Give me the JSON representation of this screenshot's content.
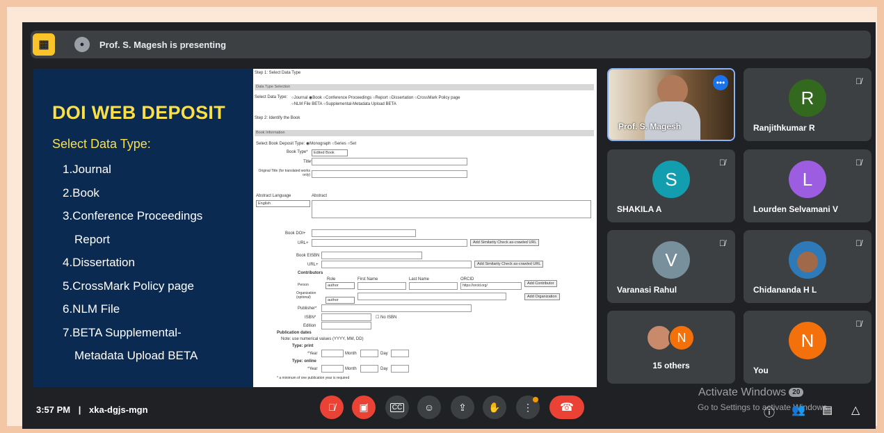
{
  "topbar": {
    "presenting_text": "Prof. S. Magesh is presenting"
  },
  "slide": {
    "title": "DOI WEB DEPOSIT",
    "subtitle": "Select Data Type:",
    "items": [
      "1.Journal",
      "2.Book",
      "3.Conference Proceedings",
      "Report",
      "4.Dissertation",
      "5.CrossMark Policy page",
      "6.NLM File",
      "7.BETA Supplemental-",
      "Metadata Upload BETA"
    ]
  },
  "form": {
    "step1": "Step 1: Select Data Type",
    "sec_type": "Data Type Selection",
    "select_label": "Select Data Type:",
    "types": "○Journal ◉Book ○Conference Proceedings ○Report ○Dissertation ○CrossMark Policy page",
    "types2": "○NLM File BETA ○Supplemental-Metadata Upload BETA",
    "step2": "Step 2: Identify the Book",
    "sec_book": "Book Information",
    "deposit_type": "Select Book Deposit Type:  ◉Monograph ○Series ○Set",
    "book_type_label": "Book Type*",
    "book_type_value": "Edited Book",
    "title_label": "Title*",
    "orig_title_label": "Original Title (for translated works only)",
    "abstract_lang_label": "Abstract Language",
    "abstract_label": "Abstract",
    "lang_value": "English",
    "book_doi": "Book DOI+",
    "url": "URL+",
    "similarity_btn": "Add Similarity Check as-crawled URL",
    "book_eisbn": "Book EISBN",
    "contributors": "Contributors",
    "role": "Role",
    "first_name": "First Name",
    "last_name": "Last Name",
    "orcid": "ORCID",
    "person": "Person",
    "author": "author",
    "orcid_value": "https://orcid.org/",
    "add_contributor": "Add Contributor",
    "organization": "Organization (optional)",
    "add_org": "Add Organization",
    "publisher": "Publisher*",
    "isbn": "ISBN*",
    "no_isbn": "No ISBN",
    "edition": "Edition",
    "pub_dates": "Publication dates",
    "pub_note": "Note: use numerical values (YYYY, MM, DD)",
    "type_print": "Type: print",
    "type_online": "Type: online",
    "year": "*Year",
    "month": "Month",
    "day": "Day",
    "min_note": "* a minimum of one publication year is required"
  },
  "tiles": [
    {
      "name": "Prof. S. Magesh"
    },
    {
      "name": "Ranjithkumar R",
      "initial": "R",
      "color": "#33691e"
    },
    {
      "name": "SHAKILA A",
      "initial": "S",
      "color": "#129eaf"
    },
    {
      "name": "Lourden Selvamani V",
      "initial": "L",
      "color": "#9c5de0"
    },
    {
      "name": "Varanasi Rahul",
      "initial": "V",
      "color": "#78909c"
    },
    {
      "name": "Chidananda H L"
    },
    {
      "name": "15 others",
      "initial": "N"
    },
    {
      "name": "You",
      "initial": "N",
      "color": "#f4700a"
    }
  ],
  "bottom": {
    "time": "3:57 PM",
    "separator": "|",
    "meeting_code": "xka-dgjs-mgn"
  },
  "watermark": {
    "line1": "Activate Windows",
    "badge": "20",
    "line2": "Go to Settings to activate Windows."
  }
}
